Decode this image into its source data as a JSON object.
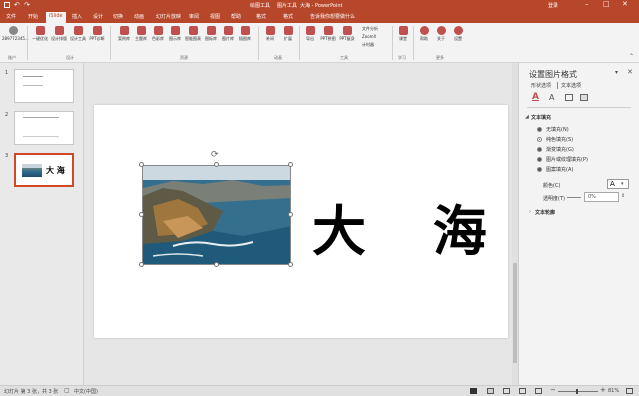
{
  "window": {
    "title": "大海 - PowerPoint",
    "context_tab_1": "绘图工具",
    "context_tab_2": "图片工具",
    "account": "登录"
  },
  "tabs": [
    "文件",
    "开始",
    "iSlide",
    "插入",
    "设计",
    "切换",
    "动画",
    "幻灯片放映",
    "审阅",
    "视图",
    "帮助",
    "格式",
    "格式",
    "告诉我你想要做什么"
  ],
  "ribbon": {
    "buttons": [
      "一键优化",
      "设计排版",
      "设计工具",
      "PPT诊断",
      "案例库",
      "主题库",
      "色彩库",
      "图示库",
      "智能图表",
      "图标库",
      "图片库",
      "插图库",
      "补间",
      "扩展",
      "导出",
      "PPT拼图",
      "PPT瘦身",
      "文件分析",
      "ZoomX",
      "计时器",
      "课堂",
      "帮助",
      "关于",
      "设置"
    ],
    "groups": [
      "账户",
      "设计",
      "资源",
      "动画",
      "工具",
      "学习",
      "更多"
    ],
    "account_id": "289772345..."
  },
  "slides": [
    {
      "num": "1"
    },
    {
      "num": "2"
    },
    {
      "num": "3",
      "thumb_text": "大 海"
    }
  ],
  "slide": {
    "text": "大 海"
  },
  "pane": {
    "title": "设置图片格式",
    "tab_shape": "形状选项",
    "tab_text": "文本选项",
    "section_fill": "文本填充",
    "options": [
      "无填充(N)",
      "纯色填充(S)",
      "渐变填充(G)",
      "图片或纹理填充(P)",
      "图案填充(A)"
    ],
    "color_label": "颜色(C)",
    "transparency_label": "透明度(T)",
    "transparency_value": "0%",
    "section_outline": "文本轮廓"
  },
  "status": {
    "left": "幻灯片 第 3 张，共 3 张",
    "lang": "中文(中国)",
    "zoom": "81%"
  },
  "colors": {
    "accent": "#b7472a"
  }
}
